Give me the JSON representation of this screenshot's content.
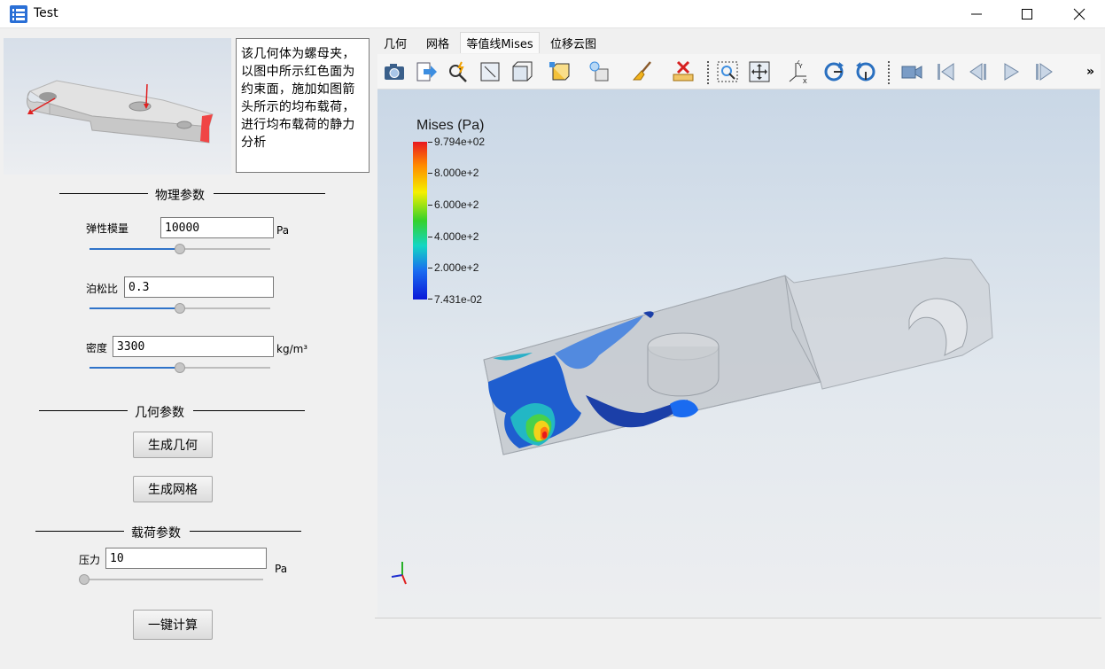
{
  "window": {
    "title": "Test",
    "controls": {
      "minimize_icon": "minimize-icon",
      "maximize_icon": "maximize-icon",
      "close_icon": "close-icon"
    }
  },
  "left_panel": {
    "description": "该几何体为螺母夹，以图中所示红色面为约束面，施加如图箭头所示的均布载荷，进行均布载荷的静力分析",
    "physics_section": {
      "title": "物理参数",
      "elastic_modulus": {
        "label": "弹性模量",
        "value": "10000",
        "unit": "Pa",
        "slider_fraction": 0.5
      },
      "poisson_ratio": {
        "label": "泊松比",
        "value": "0.3",
        "slider_fraction": 0.5
      },
      "density": {
        "label": "密度",
        "value": "3300",
        "unit": "kg/m³",
        "slider_fraction": 0.5
      }
    },
    "geometry_section": {
      "title": "几何参数",
      "generate_geometry_label": "生成几何",
      "generate_mesh_label": "生成网格"
    },
    "load_section": {
      "title": "载荷参数",
      "pressure": {
        "label": "压力",
        "value": "10",
        "unit": "Pa",
        "slider_fraction": 0.0
      },
      "compute_label": "一键计算"
    }
  },
  "tabs": [
    {
      "label": "几何",
      "active": false
    },
    {
      "label": "网格",
      "active": false
    },
    {
      "label": "等值线Mises",
      "active": true
    },
    {
      "label": "位移云图",
      "active": false
    }
  ],
  "toolbar_icons": [
    "camera-icon",
    "export-icon",
    "pick-icon",
    "fit-view-icon",
    "box-view-icon",
    "display-mode-icon",
    "lighting-icon",
    "clear-brush-icon",
    "remove-measure-icon",
    "zoom-box-icon",
    "pan-icon",
    "axes-icon",
    "rotate-cw-icon",
    "rotate-ccw-icon",
    "video-icon",
    "first-frame-icon",
    "prev-frame-icon",
    "play-icon",
    "next-frame-icon"
  ],
  "toolbar_more": "»",
  "colorbar": {
    "title": "Mises (Pa)",
    "labels": [
      "9.794e+02",
      "8.000e+2",
      "6.000e+2",
      "4.000e+2",
      "2.000e+2",
      "7.431e-02"
    ],
    "max_color": "#e8181f",
    "min_color": "#0a18d8"
  }
}
